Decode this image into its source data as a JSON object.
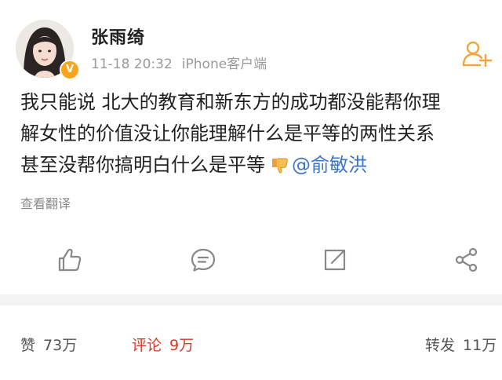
{
  "post": {
    "username": "张雨绮",
    "time": "11-18 20:32",
    "source": "iPhone客户端",
    "content_line1": "我只能说 北大的教育和新东方的成功都没能帮你理",
    "content_line2": "解女性的价值没让你能理解什么是平等的两性关系",
    "content_line3": "甚至没帮你搞明白什么是平等",
    "mention": "@俞敏洪",
    "translate": "查看翻译",
    "verified_badge": "V"
  },
  "stats": {
    "like_label": "赞",
    "like_count": "73万",
    "comment_label": "评论",
    "comment_count": "9万",
    "repost_label": "转发",
    "repost_count": "11万"
  },
  "colors": {
    "mention": "#3b74c7",
    "badge": "#f7a51d",
    "active_tab": "#d23a2c",
    "follow_icon": "#f2a53a"
  }
}
